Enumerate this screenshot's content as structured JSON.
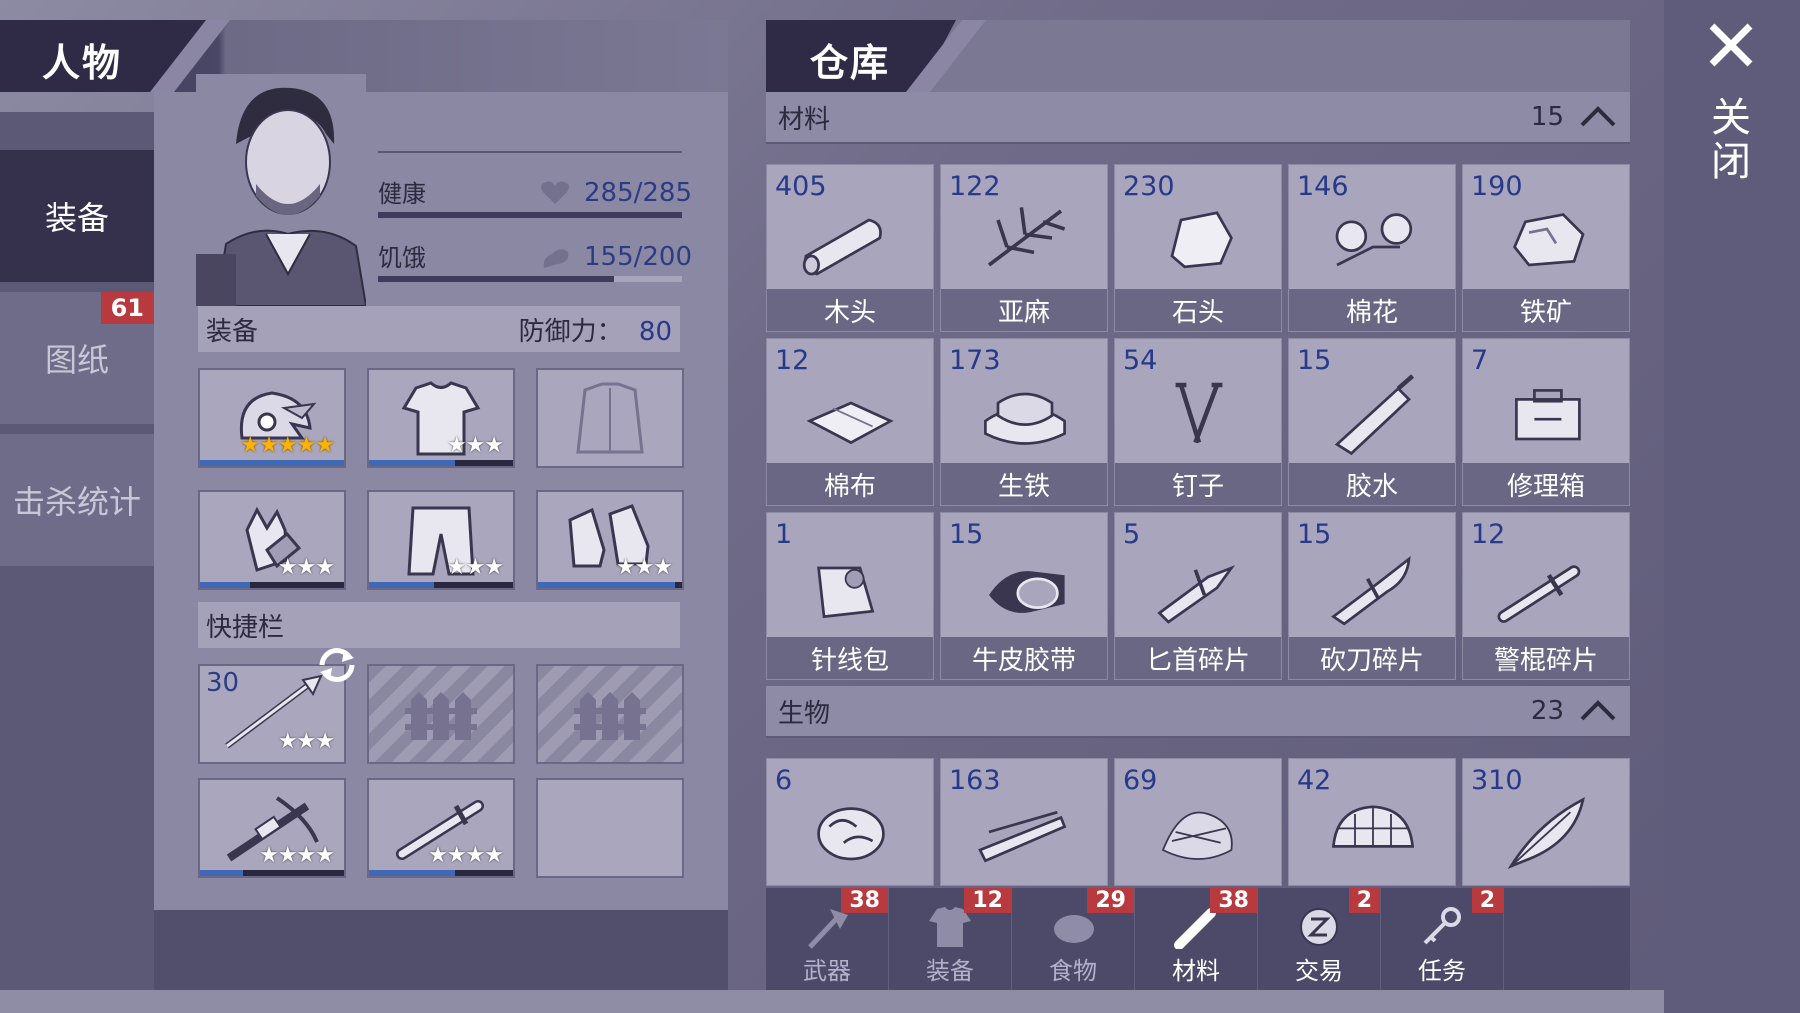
{
  "left": {
    "title": "人物",
    "side_tabs": [
      {
        "label": "装备",
        "active": true
      },
      {
        "label": "图纸",
        "badge": "61"
      },
      {
        "label": "击杀统计"
      }
    ],
    "health_label": "健康",
    "health_value": "285/285",
    "health_fraction": 1.0,
    "hunger_label": "饥饿",
    "hunger_value": "155/200",
    "hunger_fraction": 0.775,
    "equip_title": "装备",
    "defense_label": "防御力：",
    "defense_value": "80",
    "equip_slots": [
      {
        "name": "helmet",
        "stars": "★★★★★",
        "star_color": "gold",
        "durability": 1.0
      },
      {
        "name": "shirt",
        "stars": "★★★",
        "star_color": "white",
        "durability": 0.6
      },
      {
        "name": "jacket",
        "stars": "",
        "star_color": "white",
        "durability": 0
      },
      {
        "name": "gloves",
        "stars": "★★★",
        "star_color": "white",
        "durability": 0.35
      },
      {
        "name": "pants",
        "stars": "★★★",
        "star_color": "white",
        "durability": 0.45
      },
      {
        "name": "boots",
        "stars": "★★★",
        "star_color": "white",
        "durability": 0.95
      }
    ],
    "quickbar_title": "快捷栏",
    "quick_slots": [
      {
        "name": "spear",
        "count": "30",
        "stars": "★★★",
        "durability": 0
      },
      {
        "name": "locked",
        "locked": true
      },
      {
        "name": "locked",
        "locked": true
      },
      {
        "name": "crossbow",
        "stars": "★★★★",
        "durability": 0.3
      },
      {
        "name": "baton",
        "stars": "★★★★",
        "durability": 0.6
      },
      {
        "name": "empty"
      }
    ]
  },
  "right": {
    "title": "仓库",
    "materials_label": "材料",
    "materials_count": "15",
    "materials": [
      {
        "count": "405",
        "name": "木头"
      },
      {
        "count": "122",
        "name": "亚麻"
      },
      {
        "count": "230",
        "name": "石头"
      },
      {
        "count": "146",
        "name": "棉花"
      },
      {
        "count": "190",
        "name": "铁矿"
      },
      {
        "count": "12",
        "name": "棉布"
      },
      {
        "count": "173",
        "name": "生铁"
      },
      {
        "count": "54",
        "name": "钉子"
      },
      {
        "count": "15",
        "name": "胶水"
      },
      {
        "count": "7",
        "name": "修理箱"
      },
      {
        "count": "1",
        "name": "针线包"
      },
      {
        "count": "15",
        "name": "牛皮胶带"
      },
      {
        "count": "5",
        "name": "匕首碎片"
      },
      {
        "count": "15",
        "name": "砍刀碎片"
      },
      {
        "count": "12",
        "name": "警棍碎片"
      }
    ],
    "bio_label": "生物",
    "bio_count": "23",
    "bio": [
      {
        "count": "6"
      },
      {
        "count": "163"
      },
      {
        "count": "69"
      },
      {
        "count": "42"
      },
      {
        "count": "310"
      }
    ],
    "tabs": [
      {
        "label": "武器",
        "badge": "38"
      },
      {
        "label": "装备",
        "badge": "12"
      },
      {
        "label": "食物",
        "badge": "29"
      },
      {
        "label": "材料",
        "badge": "38",
        "active": true
      },
      {
        "label": "交易",
        "badge": "2",
        "active": true
      },
      {
        "label": "任务",
        "badge": "2",
        "active": true
      }
    ]
  },
  "close_label": "关闭"
}
